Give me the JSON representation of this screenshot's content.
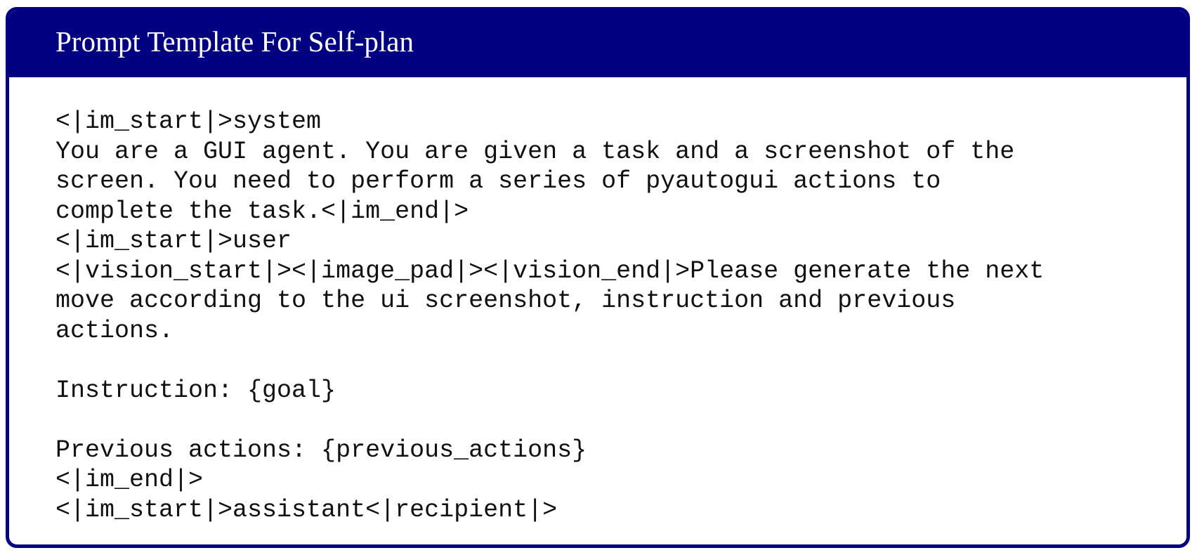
{
  "panel": {
    "title": "Prompt Template For Self-plan",
    "lines": [
      "<|im_start|>system",
      "You are a GUI agent. You are given a task and a screenshot of the",
      "screen. You need to perform a series of pyautogui actions to",
      "complete the task.<|im_end|>",
      "<|im_start|>user",
      "<|vision_start|><|image_pad|><|vision_end|>Please generate the next",
      "move according to the ui screenshot, instruction and previous",
      "actions.",
      "",
      "Instruction: {goal}",
      "",
      "Previous actions: {previous_actions}",
      "<|im_end|>",
      "<|im_start|>assistant<|recipient|>"
    ]
  },
  "colors": {
    "header_background": "#000080",
    "border": "#000080",
    "title_text": "#ffffff",
    "body_text": "#111111"
  }
}
